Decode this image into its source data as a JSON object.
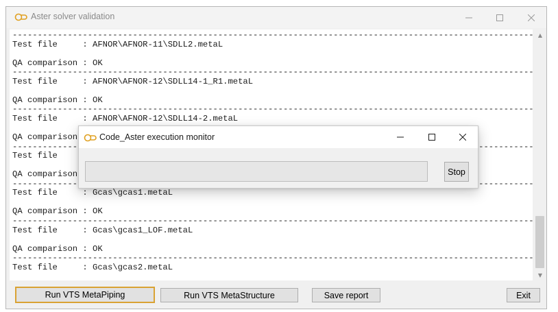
{
  "main_window": {
    "title": "Aster solver validation",
    "controls": {
      "minimize": "—",
      "maximize": "☐",
      "close": "✕"
    }
  },
  "log": {
    "lines": [
      "------------------------------------------------------------------------------------------------------------",
      "Test file     : AFNOR\\AFNOR-11\\SDLL2.metaL",
      "",
      "QA comparison : OK",
      "------------------------------------------------------------------------------------------------------------",
      "Test file     : AFNOR\\AFNOR-12\\SDLL14-1_R1.metaL",
      "",
      "QA comparison : OK",
      "------------------------------------------------------------------------------------------------------------",
      "Test file     : AFNOR\\AFNOR-12\\SDLL14-2.metaL",
      "",
      "QA comparison : OK",
      "------------------------------------------------------------------------------------------------------------",
      "Test file     : AFNOR\\AFNOR-12\\SDLL14-3.metaL",
      "",
      "QA comparison : OK",
      "------------------------------------------------------------------------------------------------------------",
      "Test file     : Gcas\\gcas1.metaL",
      "",
      "QA comparison : OK",
      "------------------------------------------------------------------------------------------------------------",
      "Test file     : Gcas\\gcas1_LOF.metaL",
      "",
      "QA comparison : OK",
      "------------------------------------------------------------------------------------------------------------",
      "Test file     : Gcas\\gcas2.metaL"
    ]
  },
  "buttons": {
    "run_metapiping": "Run VTS MetaPiping",
    "run_metastructure": "Run VTS MetaStructure",
    "save_report": "Save report",
    "exit": "Exit"
  },
  "dialog": {
    "title": "Code_Aster execution monitor",
    "stop_label": "Stop",
    "progress": 0,
    "controls": {
      "minimize": "—",
      "maximize": "☐",
      "close": "✕"
    }
  },
  "colors": {
    "focus_border": "#d9a233",
    "icon_accent": "#e0a020",
    "progress_fill": "#06b025"
  }
}
